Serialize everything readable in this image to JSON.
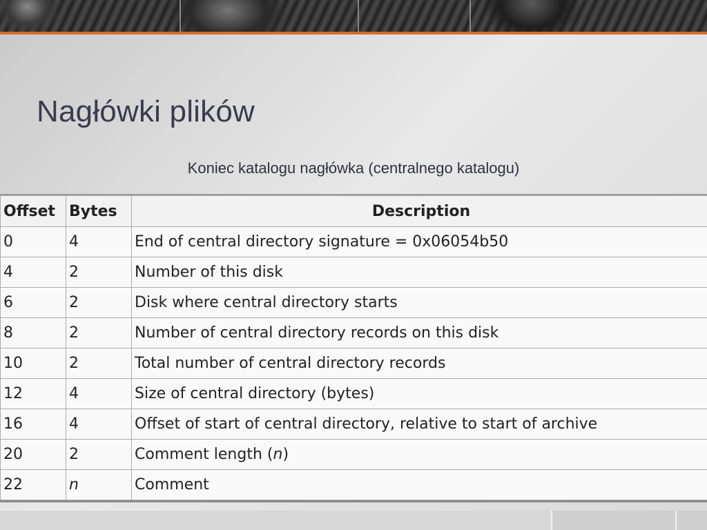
{
  "slide": {
    "title": "Nagłówki plików",
    "subtitle": "Koniec katalogu nagłówka (centralnego katalogu)"
  },
  "table": {
    "headers": {
      "offset": "Offset",
      "bytes": "Bytes",
      "description": "Description"
    },
    "rows": [
      {
        "offset": "0",
        "bytes": "4",
        "description": "End of central directory signature = 0x06054b50"
      },
      {
        "offset": "4",
        "bytes": "2",
        "description": "Number of this disk"
      },
      {
        "offset": "6",
        "bytes": "2",
        "description": "Disk where central directory starts"
      },
      {
        "offset": "8",
        "bytes": "2",
        "description": "Number of central directory records on this disk"
      },
      {
        "offset": "10",
        "bytes": "2",
        "description": "Total number of central directory records"
      },
      {
        "offset": "12",
        "bytes": "4",
        "description": "Size of central directory (bytes)"
      },
      {
        "offset": "16",
        "bytes": "4",
        "description": "Offset of start of central directory, relative to start of archive"
      },
      {
        "offset": "20",
        "bytes": "2",
        "description_prefix": "Comment length (",
        "description_var": "n",
        "description_suffix": ")"
      },
      {
        "offset": "22",
        "bytes": "n",
        "description": "Comment"
      }
    ]
  },
  "colors": {
    "accent": "#d86b2c",
    "title": "#3b3b4e"
  }
}
